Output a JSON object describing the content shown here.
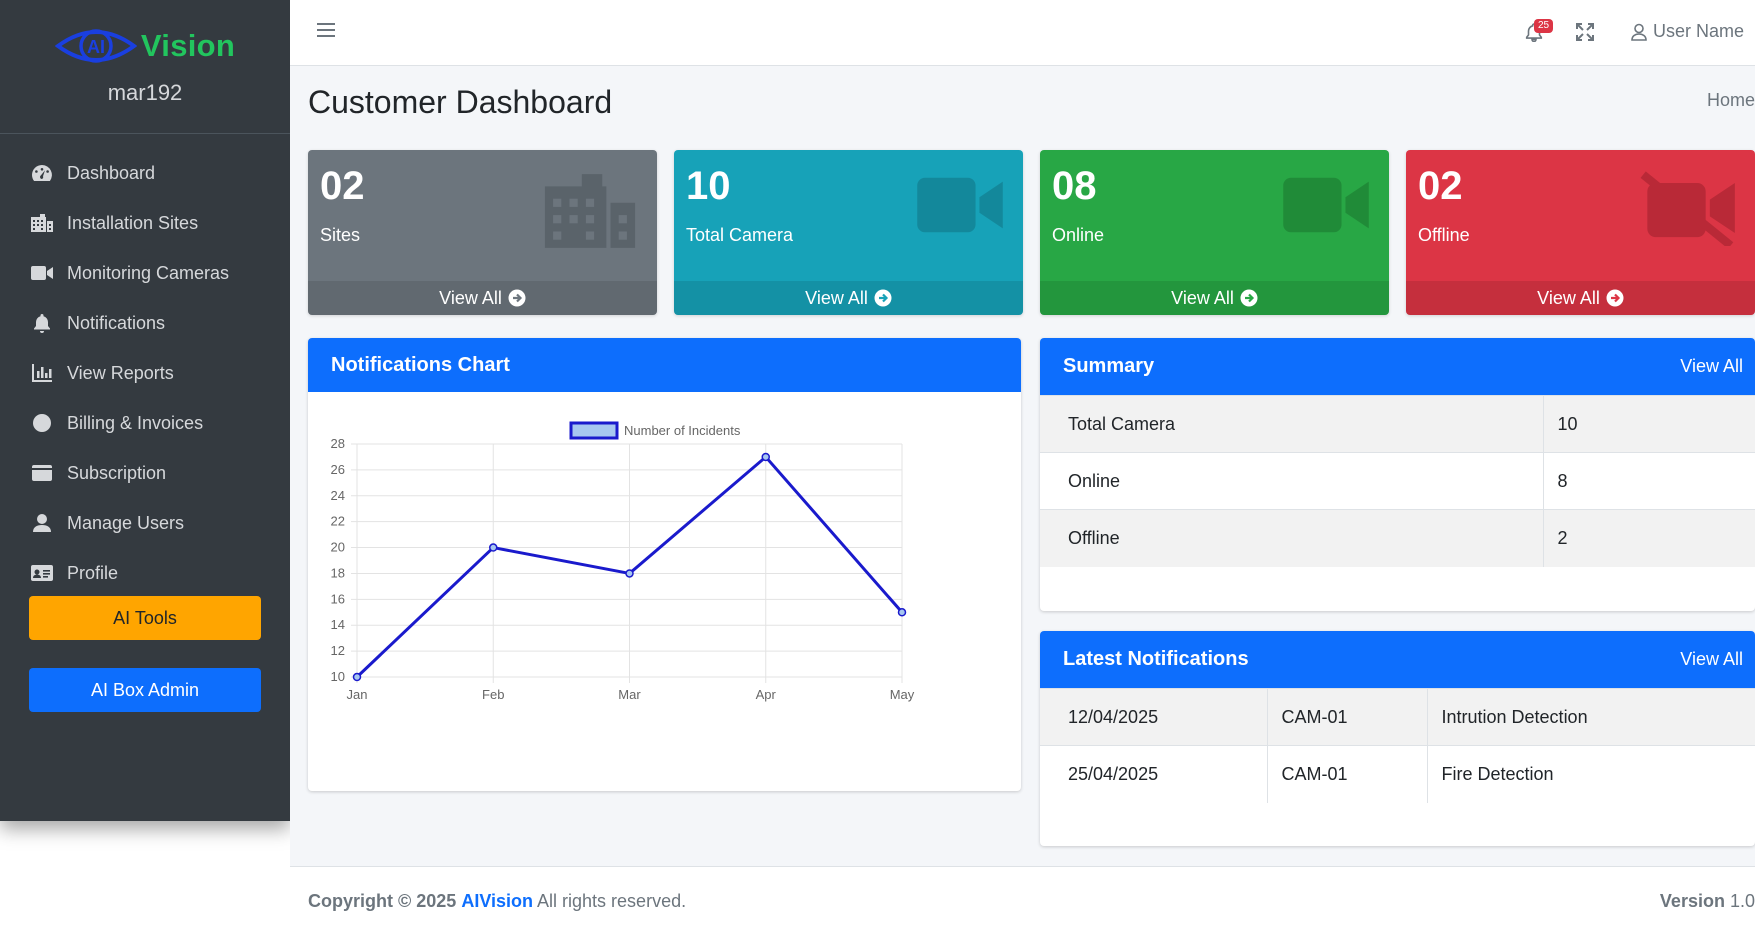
{
  "brand": {
    "name": "Vision",
    "logo_mark": "AI",
    "username": "mar192"
  },
  "sidebar": {
    "items": [
      {
        "label": "Dashboard",
        "icon": "dashboard-icon"
      },
      {
        "label": "Installation Sites",
        "icon": "building-icon"
      },
      {
        "label": "Monitoring Cameras",
        "icon": "video-camera-icon"
      },
      {
        "label": "Notifications",
        "icon": "bell-icon"
      },
      {
        "label": "View Reports",
        "icon": "bar-chart-icon"
      },
      {
        "label": "Billing & Invoices",
        "icon": "circle-icon"
      },
      {
        "label": "Subscription",
        "icon": "wallet-icon"
      },
      {
        "label": "Manage Users",
        "icon": "user-icon"
      },
      {
        "label": "Profile",
        "icon": "id-card-icon"
      }
    ],
    "ai_tools_label": "AI Tools",
    "ai_box_admin_label": "AI Box Admin",
    "colors": {
      "ai_tools": "#ffa500",
      "ai_box_admin": "#0d6efd"
    }
  },
  "header": {
    "notification_count": "25",
    "user_name": "User Name"
  },
  "page": {
    "title": "Customer Dashboard",
    "breadcrumb": "Home"
  },
  "stats": [
    {
      "value": "02",
      "label": "Sites",
      "link": "View All",
      "color": "#6c757d",
      "icon": "building-icon"
    },
    {
      "value": "10",
      "label": "Total Camera",
      "link": "View All",
      "color": "#17a2b8",
      "icon": "video-camera-icon"
    },
    {
      "value": "08",
      "label": "Online",
      "link": "View All",
      "color": "#28a745",
      "icon": "video-camera-icon"
    },
    {
      "value": "02",
      "label": "Offline",
      "link": "View All",
      "color": "#dc3545",
      "icon": "video-camera-slash-icon"
    }
  ],
  "notifications_chart": {
    "title": "Notifications Chart"
  },
  "chart_data": {
    "type": "line",
    "categories": [
      "Jan",
      "Feb",
      "Mar",
      "Apr",
      "May"
    ],
    "series": [
      {
        "name": "Number of Incidents",
        "values": [
          10,
          20,
          18,
          27,
          15
        ],
        "color": "#1a1acc"
      }
    ],
    "ylim": [
      10,
      28
    ],
    "yticks": [
      10,
      12,
      14,
      16,
      18,
      20,
      22,
      24,
      26,
      28
    ],
    "grid": true,
    "legend": "top"
  },
  "summary": {
    "title": "Summary",
    "view_all": "View All",
    "rows": [
      {
        "label": "Total Camera",
        "value": "10"
      },
      {
        "label": "Online",
        "value": "8"
      },
      {
        "label": "Offline",
        "value": "2"
      }
    ]
  },
  "latest_notifications": {
    "title": "Latest Notifications",
    "view_all": "View All",
    "rows": [
      {
        "date": "12/04/2025",
        "camera": "CAM-01",
        "type": "Intrution Detection"
      },
      {
        "date": "25/04/2025",
        "camera": "CAM-01",
        "type": "Fire Detection"
      }
    ]
  },
  "footer": {
    "copyright": "Copyright © 2025",
    "brand": "AIVision",
    "rights": "All rights reserved.",
    "version_label": "Version",
    "version": "1.0"
  }
}
